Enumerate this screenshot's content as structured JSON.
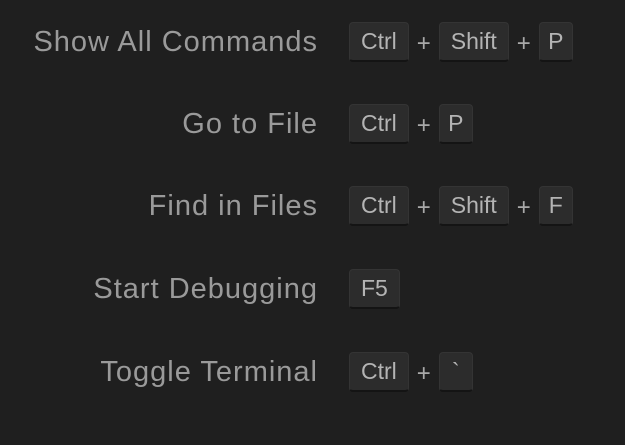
{
  "shortcuts": [
    {
      "command": "Show All Commands",
      "keys": [
        "Ctrl",
        "Shift",
        "P"
      ],
      "separator": "+"
    },
    {
      "command": "Go to File",
      "keys": [
        "Ctrl",
        "P"
      ],
      "separator": "+"
    },
    {
      "command": "Find in Files",
      "keys": [
        "Ctrl",
        "Shift",
        "F"
      ],
      "separator": "+"
    },
    {
      "command": "Start Debugging",
      "keys": [
        "F5"
      ],
      "separator": "+"
    },
    {
      "command": "Toggle Terminal",
      "keys": [
        "Ctrl",
        "`"
      ],
      "separator": "+"
    }
  ]
}
